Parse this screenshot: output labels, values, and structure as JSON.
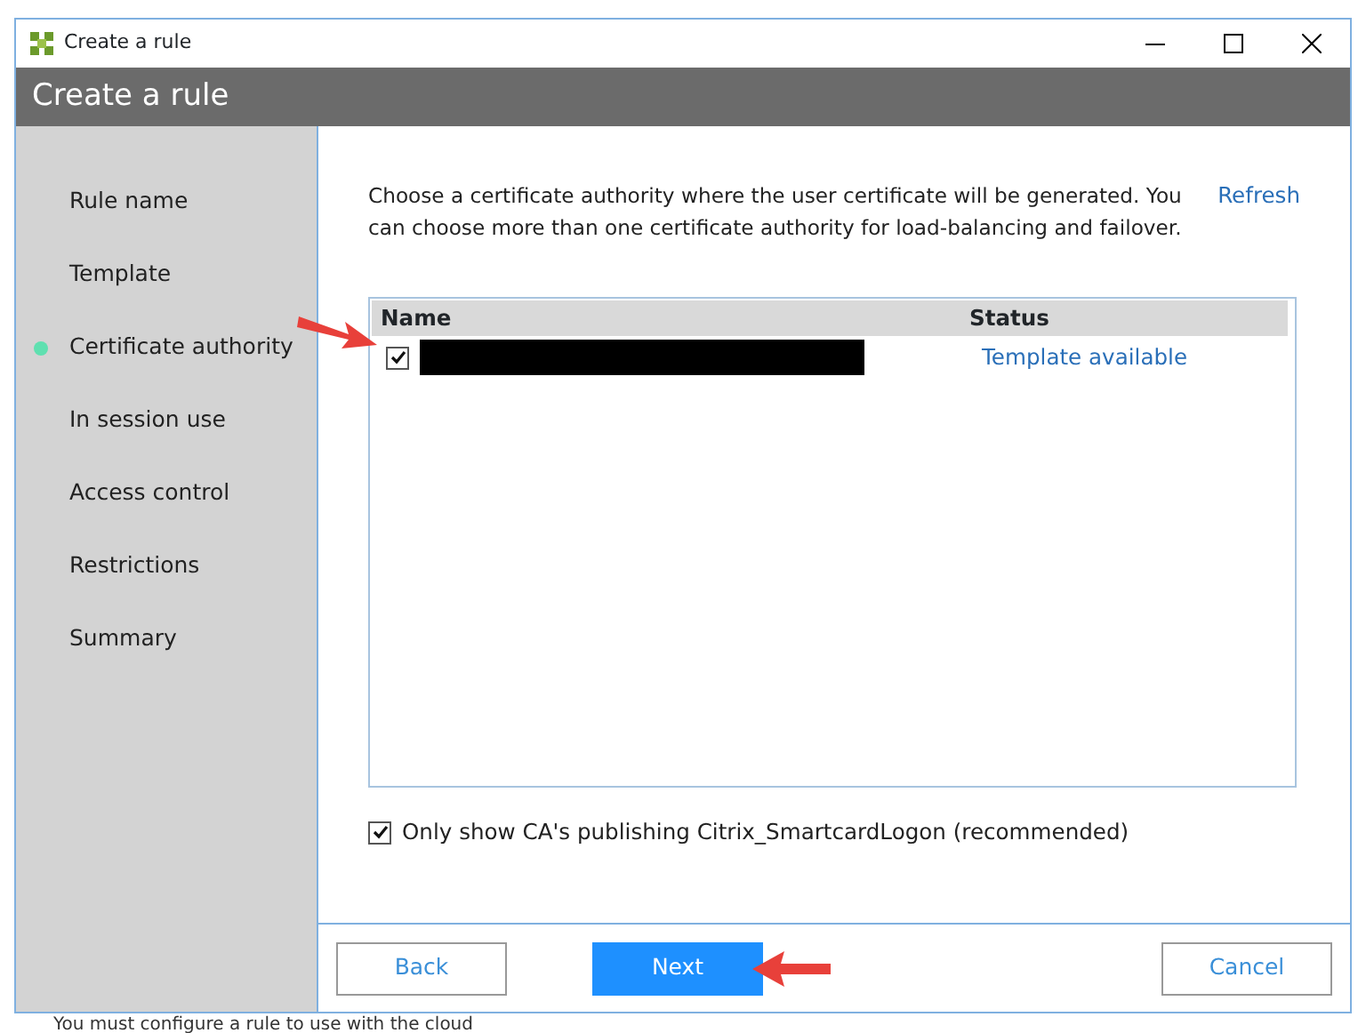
{
  "window": {
    "title": "Create a rule"
  },
  "header": {
    "title": "Create a rule"
  },
  "steps": [
    {
      "label": "Rule name",
      "selected": false
    },
    {
      "label": "Template",
      "selected": false
    },
    {
      "label": "Certificate authority",
      "selected": true
    },
    {
      "label": "In session use",
      "selected": false
    },
    {
      "label": "Access control",
      "selected": false
    },
    {
      "label": "Restrictions",
      "selected": false
    },
    {
      "label": "Summary",
      "selected": false
    }
  ],
  "intro": "Choose a certificate authority where the user certificate will be generated. You can choose more than one certificate authority for load-balancing and failover.",
  "refresh_link": "Refresh",
  "table": {
    "columns": [
      "Name",
      "Status"
    ],
    "rows": [
      {
        "checked": true,
        "redacted": true,
        "status": "Template available",
        "pointed_at": true
      }
    ]
  },
  "filter": {
    "label": "Only show CA's publishing Citrix_SmartcardLogon (recommended)",
    "checked": true
  },
  "buttons": [
    {
      "label": "Back",
      "kind": "secondary",
      "pointed_at": false
    },
    {
      "label": "Next",
      "kind": "primary",
      "pointed_at": true
    },
    {
      "label": "Cancel",
      "kind": "secondary",
      "pointed_at": false
    }
  ],
  "background_text": "You must configure a rule to use with the cloud"
}
